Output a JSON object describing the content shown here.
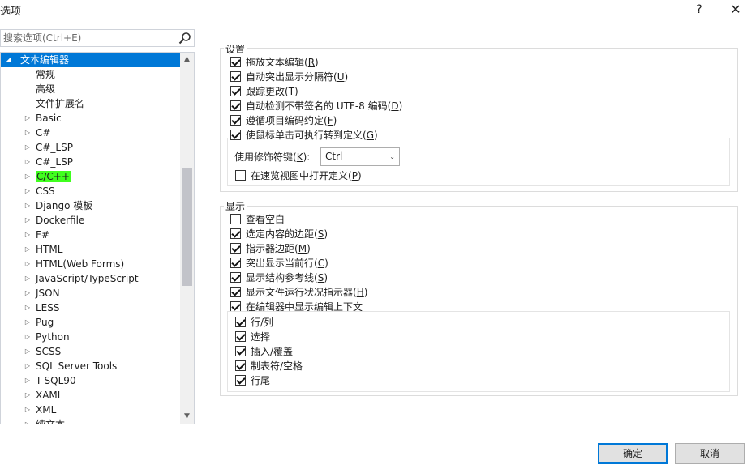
{
  "window": {
    "title": "选项",
    "help": "?",
    "close": "✕"
  },
  "search": {
    "placeholder": "搜索选项(Ctrl+E)"
  },
  "tree": {
    "root": "文本编辑器",
    "children": [
      "常规",
      "高级",
      "文件扩展名"
    ],
    "languages": [
      "Basic",
      "C#",
      "C#_LSP",
      "C#_LSP",
      "C/C++",
      "CSS",
      "Django 模板",
      "Dockerfile",
      "F#",
      "HTML",
      "HTML(Web Forms)",
      "JavaScript/TypeScript",
      "JSON",
      "LESS",
      "Pug",
      "Python",
      "SCSS",
      "SQL Server Tools",
      "T-SQL90",
      "XAML",
      "XML",
      "纯文本"
    ],
    "highlighted_item": "C/C++",
    "highlight_color": "#40ff1f",
    "selected_color": "#0078d7"
  },
  "settings": {
    "title": "设置",
    "options": [
      {
        "text": "拖放文本编辑",
        "key": "R",
        "checked": true
      },
      {
        "text": "自动突出显示分隔符",
        "key": "U",
        "checked": true
      },
      {
        "text": "跟踪更改",
        "key": "T",
        "checked": true
      },
      {
        "text": "自动检测不带签名的 UTF-8 编码",
        "key": "D",
        "checked": true
      },
      {
        "text": "遵循项目编码约定",
        "key": "F",
        "checked": true
      },
      {
        "text": "使鼠标单击可执行转到定义",
        "key": "G",
        "checked": true
      }
    ],
    "modifier_label": "使用修饰符键",
    "modifier_key": "K",
    "modifier_value": "Ctrl",
    "peek": {
      "text": "在速览视图中打开定义",
      "key": "P",
      "checked": false
    }
  },
  "display": {
    "title": "显示",
    "options": [
      {
        "text": "查看空白",
        "key": "",
        "checked": false
      },
      {
        "text": "选定内容的边距",
        "key": "S",
        "checked": true
      },
      {
        "text": "指示器边距",
        "key": "M",
        "checked": true
      },
      {
        "text": "突出显示当前行",
        "key": "C",
        "checked": true
      },
      {
        "text": "显示结构参考线",
        "key": "S",
        "checked": true
      },
      {
        "text": "显示文件运行状况指示器",
        "key": "H",
        "checked": true
      },
      {
        "text": "在编辑器中显示编辑上下文",
        "key": "",
        "checked": true
      }
    ],
    "context_options": [
      {
        "text": "行/列",
        "checked": true
      },
      {
        "text": "选择",
        "checked": true
      },
      {
        "text": "插入/覆盖",
        "checked": true
      },
      {
        "text": "制表符/空格",
        "checked": true
      },
      {
        "text": "行尾",
        "checked": true
      }
    ]
  },
  "buttons": {
    "ok": "确定",
    "cancel": "取消"
  }
}
